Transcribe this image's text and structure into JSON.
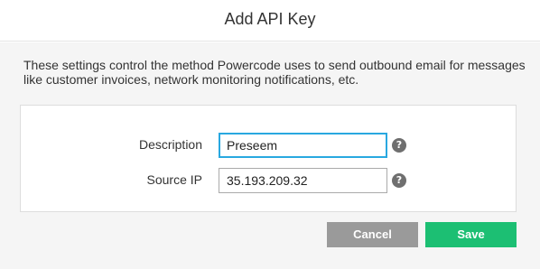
{
  "dialog": {
    "title": "Add API Key",
    "description": "These settings control the method Powercode uses to send outbound email for messages like customer invoices, network monitoring notifications, etc."
  },
  "form": {
    "description_label": "Description",
    "description_value": "Preseem",
    "source_ip_label": "Source IP",
    "source_ip_value": "35.193.209.32",
    "help_icon_glyph": "?"
  },
  "buttons": {
    "cancel_label": "Cancel",
    "save_label": "Save"
  },
  "colors": {
    "focus_border": "#29a8e0",
    "save_button": "#1cbf73",
    "cancel_button": "#9a9a9a",
    "help_icon": "#6f6f6f"
  },
  "icons": {
    "help": "question-circle-icon"
  }
}
